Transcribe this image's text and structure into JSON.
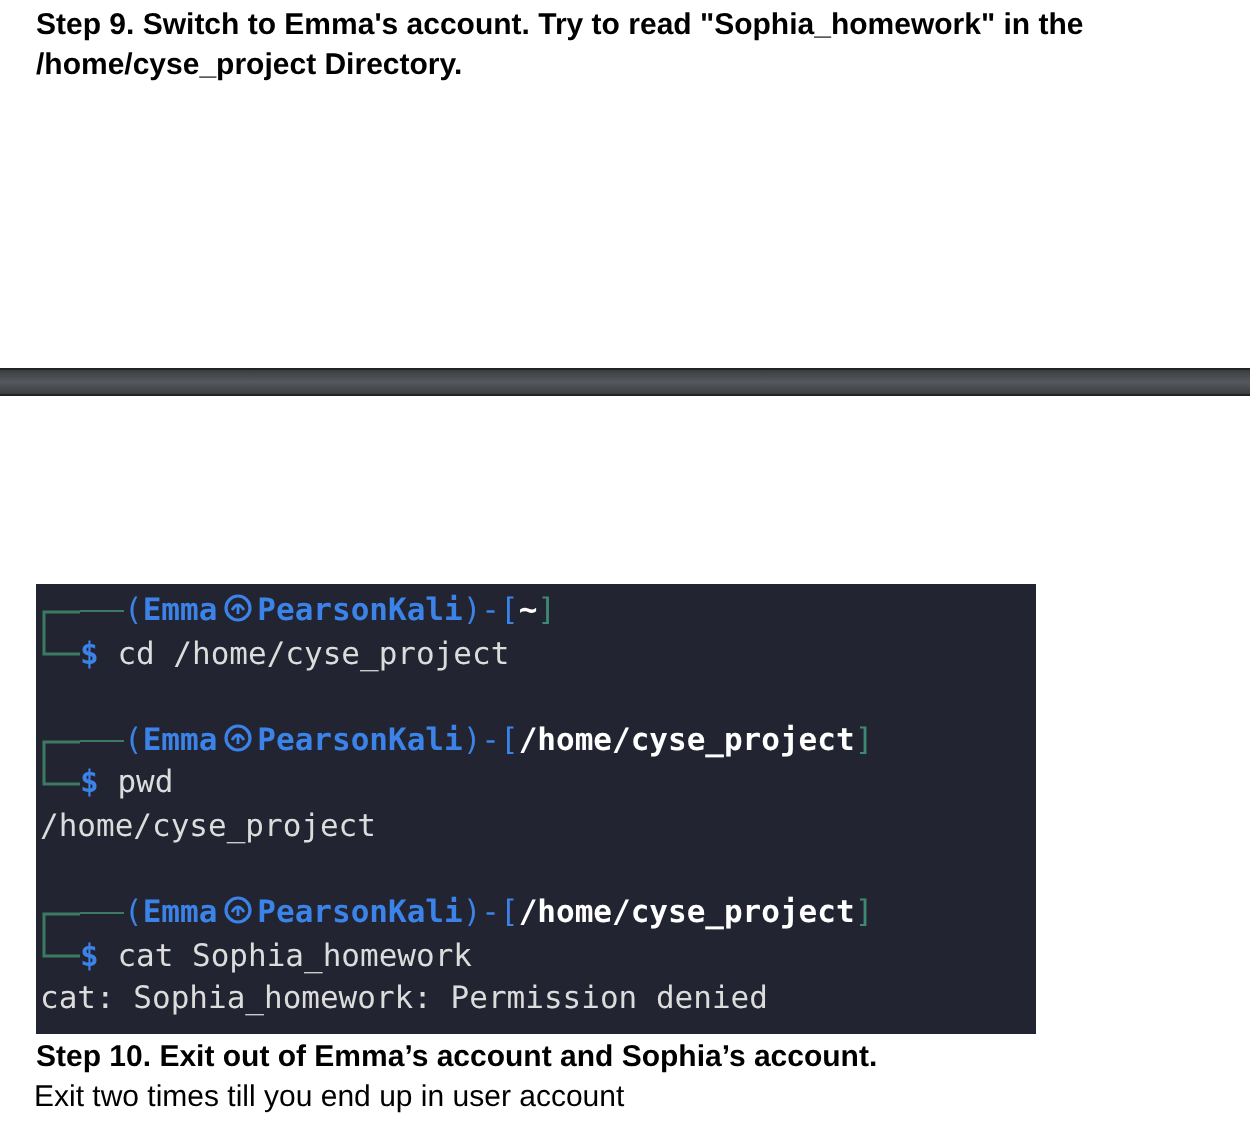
{
  "heading": "Step 9. Switch to Emma's account. Try to read \"Sophia_homework\" in the /home/cyse_project Directory.",
  "terminal": {
    "blocks": [
      {
        "kind": "prompt",
        "open": "(",
        "user": "Emma",
        "host": "PearsonKali",
        "middle": ")-[",
        "path": "~",
        "close": "]",
        "sigil": "$",
        "command": "cd /home/cyse_project"
      },
      {
        "kind": "blank"
      },
      {
        "kind": "prompt",
        "open": "(",
        "user": "Emma",
        "host": "PearsonKali",
        "middle": ")-[",
        "path": "/home/cyse_project",
        "close": "]",
        "sigil": "$",
        "command": "pwd"
      },
      {
        "kind": "output",
        "text": "/home/cyse_project"
      },
      {
        "kind": "blank"
      },
      {
        "kind": "prompt",
        "open": "(",
        "user": "Emma",
        "host": "PearsonKali",
        "middle": ")-[",
        "path": "/home/cyse_project",
        "close": "]",
        "sigil": "$",
        "command": "cat Sophia_homework"
      },
      {
        "kind": "output",
        "text": "cat: Sophia_homework: Permission denied"
      }
    ]
  },
  "step": {
    "title": "Step 10. Exit out of Emma’s account and Sophia’s account.",
    "text": "Exit two times till  you end up in user account"
  }
}
